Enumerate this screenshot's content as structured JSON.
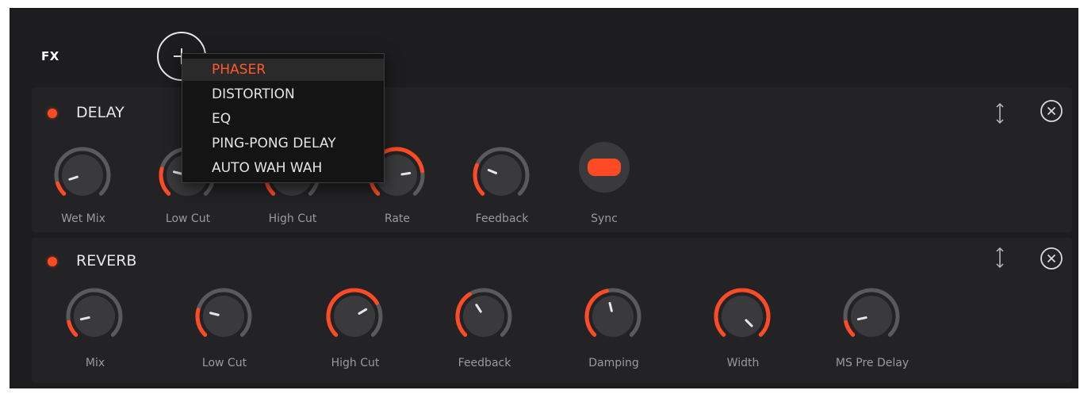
{
  "header": {
    "title": "FX"
  },
  "add_menu": {
    "items": [
      {
        "label": "PHASER",
        "selected": true
      },
      {
        "label": "DISTORTION",
        "selected": false
      },
      {
        "label": "EQ",
        "selected": false
      },
      {
        "label": "PING-PONG DELAY",
        "selected": false
      },
      {
        "label": "AUTO WAH WAH",
        "selected": false
      }
    ]
  },
  "effects": [
    {
      "name": "DELAY",
      "enabled": true,
      "knobs": [
        {
          "label": "Wet Mix",
          "value": 0.1
        },
        {
          "label": "Low Cut",
          "value": 0.22
        },
        {
          "label": "High Cut",
          "value": 0.78
        },
        {
          "label": "Rate",
          "value": 0.8
        },
        {
          "label": "Feedback",
          "value": 0.25
        }
      ],
      "toggle": {
        "label": "Sync",
        "on": true
      }
    },
    {
      "name": "REVERB",
      "enabled": true,
      "knobs": [
        {
          "label": "Mix",
          "value": 0.12
        },
        {
          "label": "Low Cut",
          "value": 0.22
        },
        {
          "label": "High Cut",
          "value": 0.72
        },
        {
          "label": "Feedback",
          "value": 0.38
        },
        {
          "label": "Damping",
          "value": 0.45
        },
        {
          "label": "Width",
          "value": 1.0
        },
        {
          "label": "MS Pre Delay",
          "value": 0.12
        }
      ]
    }
  ],
  "colors": {
    "accent": "#ff4a24",
    "track": "#5a5a5c",
    "knob_body": "#3a3a3c",
    "background": "#1d1d1f",
    "panel": "#232325"
  },
  "icons": {
    "add": "plus-circle-icon",
    "move": "vertical-move-icon",
    "close": "close-circle-icon",
    "power": "power-led-icon"
  }
}
